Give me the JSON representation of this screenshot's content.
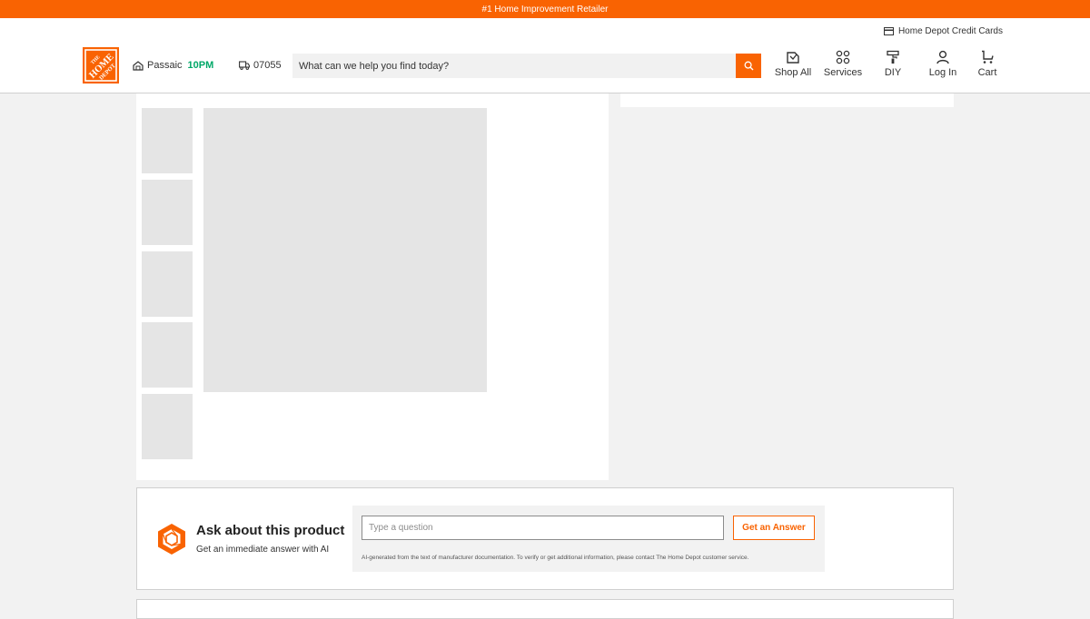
{
  "promo_bar": {
    "text": "#1 Home Improvement Retailer"
  },
  "header": {
    "credit_cards_label": "Home Depot Credit Cards",
    "logo_alt": "The Home Depot",
    "store": {
      "name": "Passaic",
      "hours": "10PM"
    },
    "delivery_zip": "07055",
    "search": {
      "placeholder": "What can we help you find today?",
      "value": ""
    },
    "nav": [
      {
        "label": "Shop All",
        "icon": "shop-all-icon"
      },
      {
        "label": "Services",
        "icon": "services-icon"
      },
      {
        "label": "DIY",
        "icon": "paint-roller-icon"
      },
      {
        "label": "Log In",
        "icon": "user-icon"
      },
      {
        "label": "Cart",
        "icon": "cart-icon"
      }
    ]
  },
  "product": {
    "thumbnails": [
      "",
      "",
      "",
      "",
      ""
    ],
    "main_image": ""
  },
  "ask": {
    "title": "Ask about this product",
    "subtitle": "Get an immediate answer with AI",
    "input_placeholder": "Type a question",
    "input_value": "",
    "button_label": "Get an Answer",
    "disclaimer": "AI-generated from the text of manufacturer documentation. To verify or get additional information, please contact The Home Depot customer service."
  },
  "colors": {
    "brand_orange": "#f96302",
    "store_hours_green": "#00a868",
    "page_background": "#f2f2f2",
    "placeholder_gray": "#e5e5e5"
  }
}
